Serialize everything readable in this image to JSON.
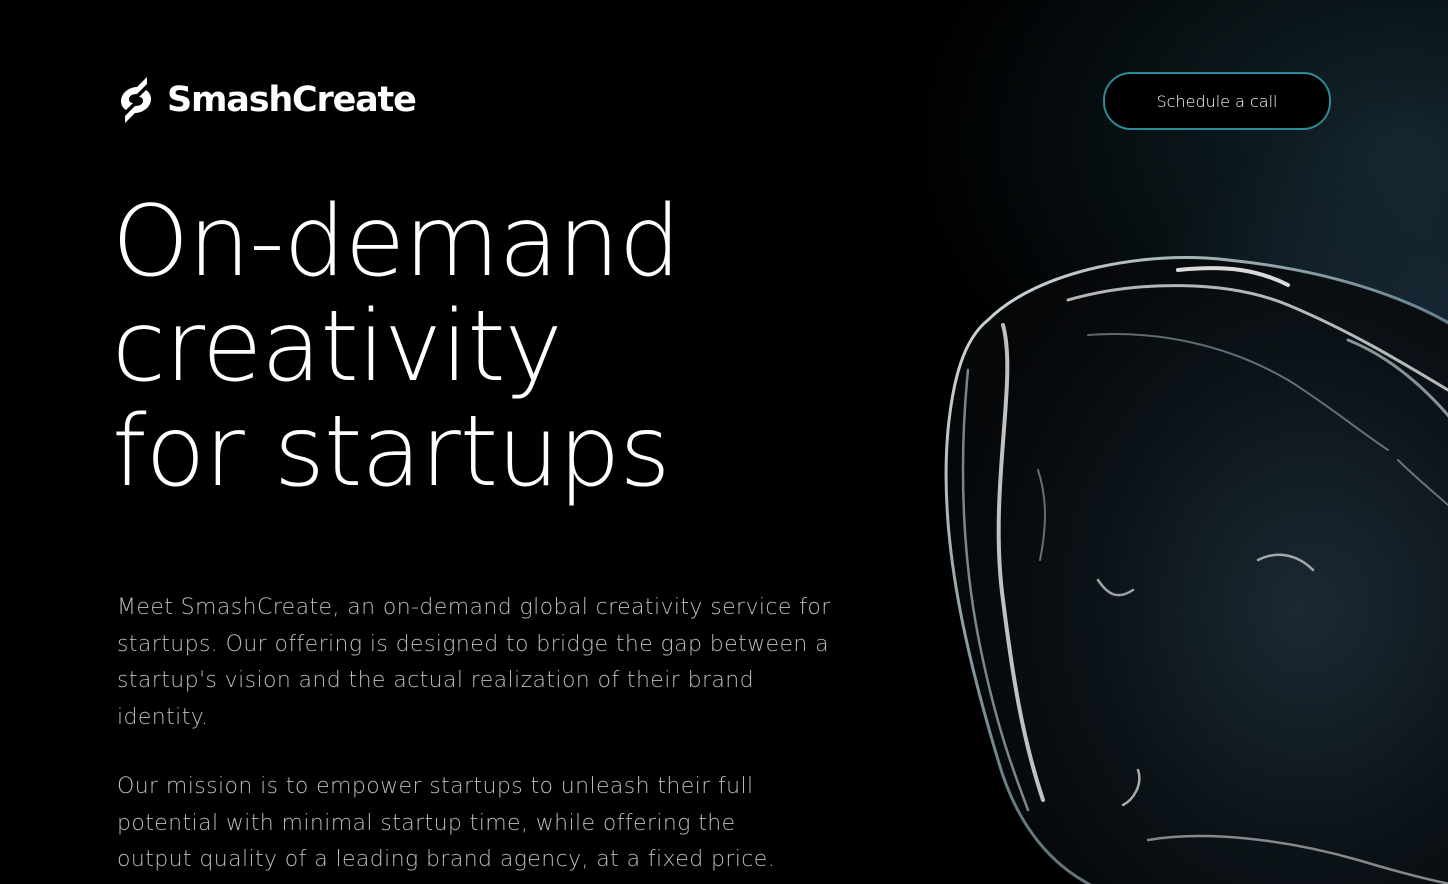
{
  "brand": {
    "name": "SmashCreate",
    "logo_icon": "smashcreate-s-icon"
  },
  "header": {
    "cta_label": "Schedule a call"
  },
  "hero": {
    "title_lines": [
      "On-demand",
      "creativity",
      "for startups"
    ],
    "intro": "Meet SmashCreate, an on-demand global creativity service for startups. Our offering is designed to bridge the gap between a startup's vision and the actual realization of their brand identity.",
    "mission": "Our mission is to empower startups to unleash their full potential with minimal startup time, while offering the output quality of a leading brand agency, at a fixed price."
  },
  "visual": {
    "decoration": "glass-blob-3d-render"
  },
  "colors": {
    "background": "#000000",
    "text": "#ffffff",
    "body_text": "#bdbdbd",
    "button_border": "#2d8a97",
    "glow": "#6076aa"
  }
}
